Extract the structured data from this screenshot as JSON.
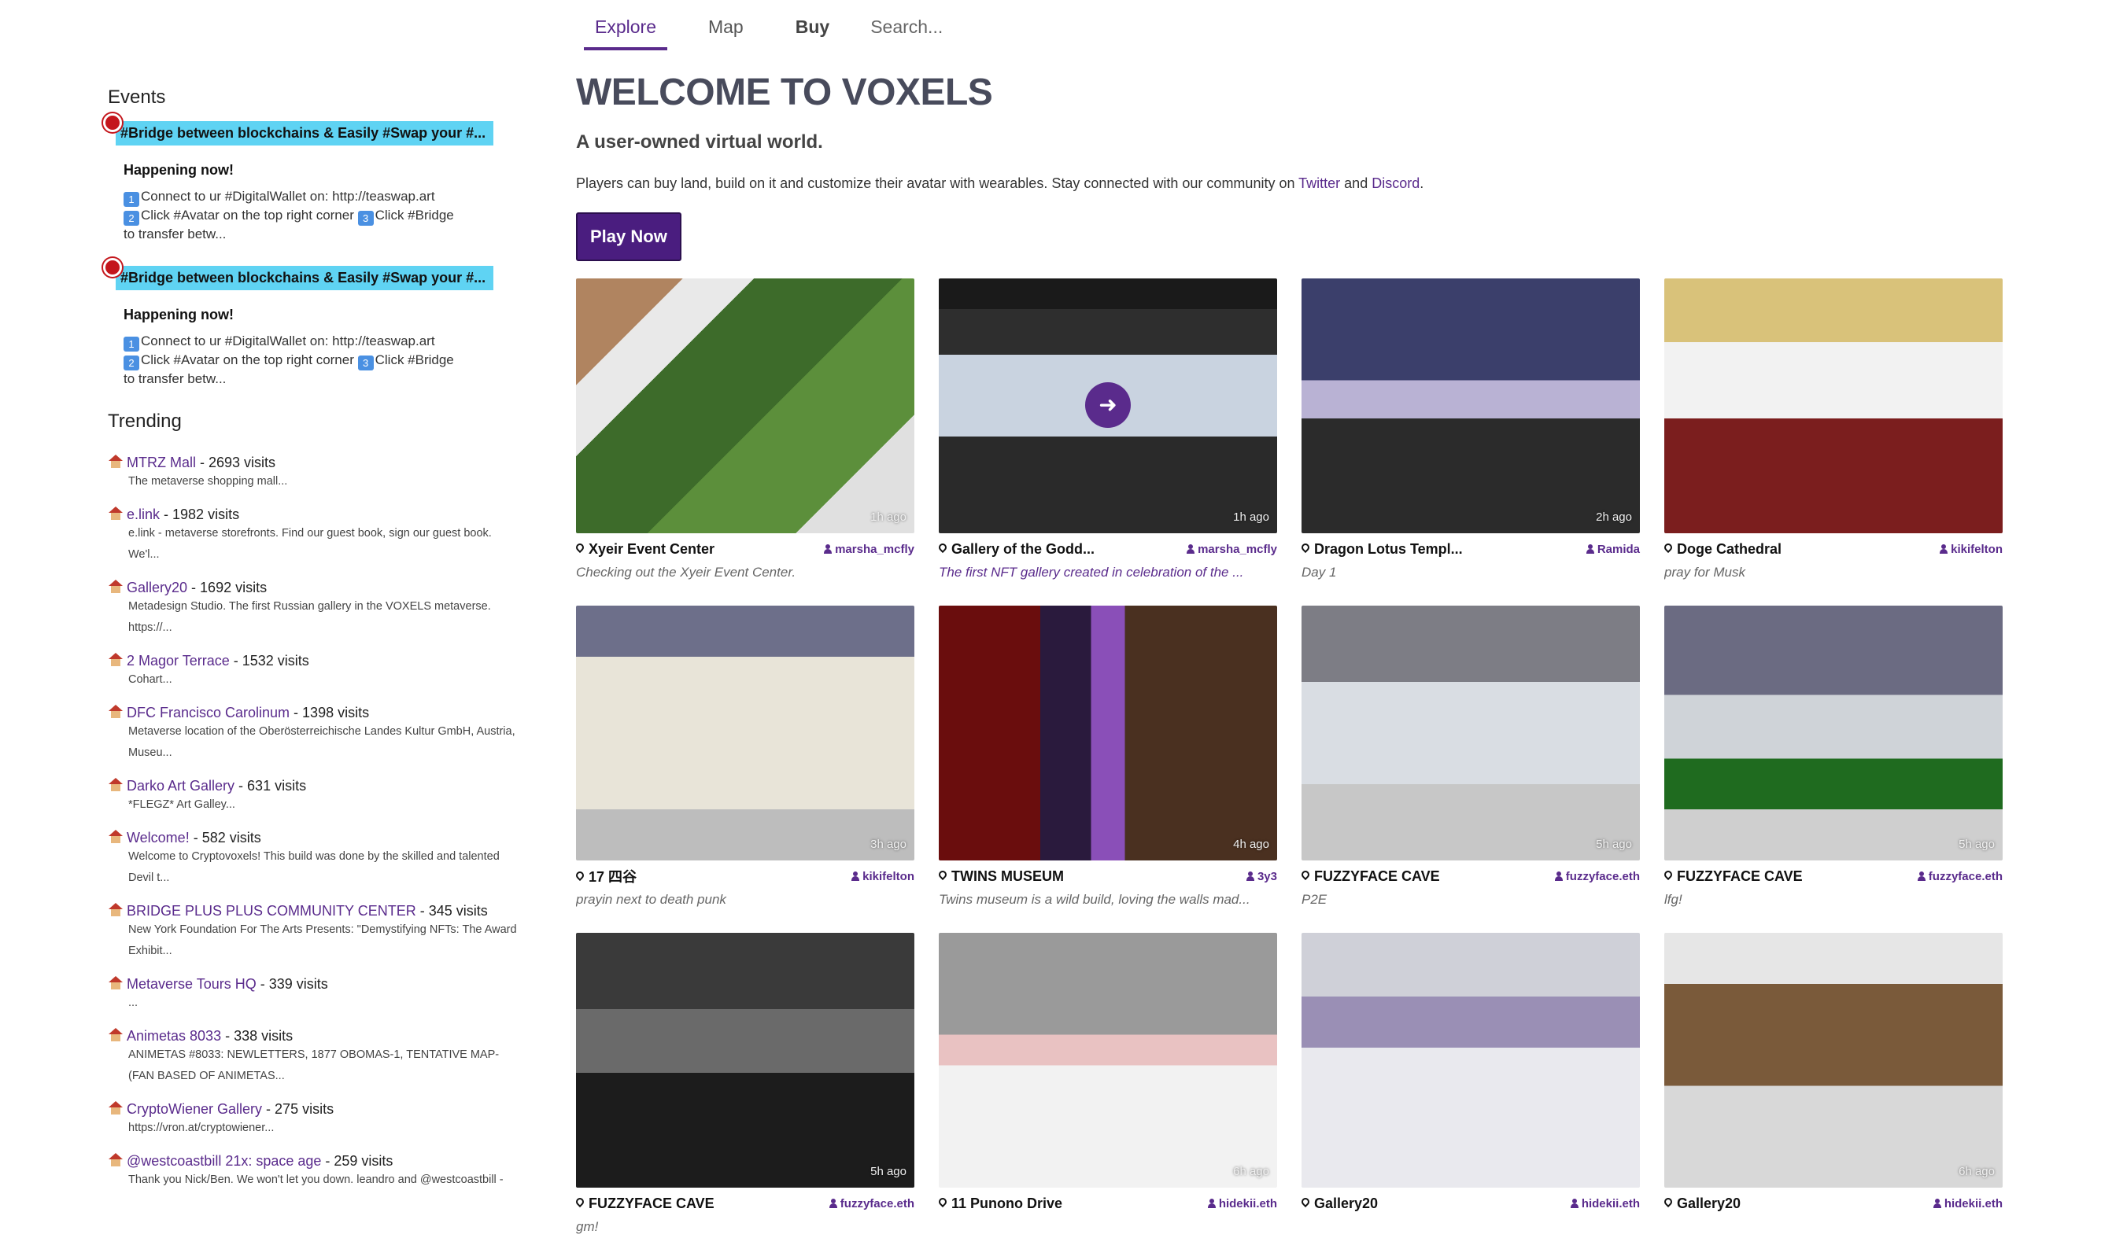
{
  "nav": {
    "items": [
      {
        "label": "Explore"
      },
      {
        "label": "Map"
      },
      {
        "label": "Buy"
      }
    ],
    "search_placeholder": "Search..."
  },
  "sidebar": {
    "events_heading": "Events",
    "events": [
      {
        "title": "#Bridge between blockchains & Easily #Swap your #...",
        "status": "Happening now!",
        "line1": "Connect to ur #DigitalWallet on: http://teaswap.art",
        "line2a": "Click #Avatar on the top right corner ",
        "line2b": "Click #Bridge",
        "line3": "to transfer betw..."
      },
      {
        "title": "#Bridge between blockchains & Easily #Swap your #...",
        "status": "Happening now!",
        "line1": "Connect to ur #DigitalWallet on: http://teaswap.art",
        "line2a": "Click #Avatar on the top right corner ",
        "line2b": "Click #Bridge",
        "line3": "to transfer betw..."
      }
    ],
    "trending_heading": "Trending",
    "trending": [
      {
        "name": "MTRZ Mall",
        "visits": " - 2693 visits",
        "desc": "The metaverse shopping mall..."
      },
      {
        "name": "e.link",
        "visits": " - 1982 visits",
        "desc": "e.link - metaverse storefronts. Find our guest book, sign our guest book. We'l..."
      },
      {
        "name": "Gallery20",
        "visits": " - 1692 visits",
        "desc": "Metadesign Studio. The first Russian gallery in the VOXELS metaverse. https://..."
      },
      {
        "name": "2 Magor Terrace",
        "visits": " - 1532 visits",
        "desc": "Cohart..."
      },
      {
        "name": "DFC Francisco Carolinum",
        "visits": " - 1398 visits",
        "desc": "Metaverse location of the Oberösterreichische Landes Kultur GmbH, Austria, Museu..."
      },
      {
        "name": "Darko Art Gallery",
        "visits": " - 631 visits",
        "desc": "*FLEGZ* Art Galley..."
      },
      {
        "name": "Welcome!",
        "visits": " - 582 visits",
        "desc": "Welcome to Cryptovoxels! This build was done by the skilled and talented Devil t..."
      },
      {
        "name": "BRIDGE PLUS PLUS COMMUNITY CENTER",
        "visits": " - 345 visits",
        "desc": "New York Foundation For The Arts Presents: \"Demystifying NFTs: The Award Exhibit..."
      },
      {
        "name": "Metaverse Tours HQ",
        "visits": " - 339 visits",
        "desc": "..."
      },
      {
        "name": "Animetas 8033",
        "visits": " - 338 visits",
        "desc": "ANIMETAS #8033: NEWLETTERS, 1877 OBOMAS-1, TENTATIVE MAP- (FAN BASED OF ANIMETAS..."
      },
      {
        "name": "CryptoWiener Gallery",
        "visits": " - 275 visits",
        "desc": "https://vron.at/cryptowiener..."
      },
      {
        "name": "@westcoastbill 21x: space age",
        "visits": " - 259 visits",
        "desc": "Thank you Nick/Ben. We won't let you down. leandro and @westcoastbill -"
      }
    ]
  },
  "main": {
    "title": "WELCOME TO VOXELS",
    "subtitle": "A user-owned virtual world.",
    "intro_prefix": "Players can buy land, build on it and customize their avatar with wearables. Stay connected with our community on ",
    "intro_link1": "Twitter",
    "intro_mid": " and ",
    "intro_link2": "Discord",
    "intro_suffix": ".",
    "play_label": "Play Now"
  },
  "cards": [
    {
      "title": "Xyeir Event Center",
      "author": "marsha_mcfly",
      "time": "1h ago",
      "desc": "Checking out the Xyeir Event Center.",
      "desc_purple": false,
      "play": false
    },
    {
      "title": "Gallery of the Godd...",
      "author": "marsha_mcfly",
      "time": "1h ago",
      "desc": "The first NFT gallery created in celebration of the ...",
      "desc_purple": true,
      "play": true
    },
    {
      "title": "Dragon Lotus Templ...",
      "author": "Ramida",
      "time": "2h ago",
      "desc": "Day 1",
      "desc_purple": false,
      "play": false
    },
    {
      "title": "Doge Cathedral",
      "author": "kikifelton",
      "time": "",
      "desc": "pray for Musk",
      "desc_purple": false,
      "play": false
    },
    {
      "title": "17 四谷",
      "author": "kikifelton",
      "time": "3h ago",
      "desc": "prayin next to death punk",
      "desc_purple": false,
      "play": false
    },
    {
      "title": "TWINS MUSEUM",
      "author": "3y3",
      "time": "4h ago",
      "desc": "Twins museum is a wild build, loving the walls mad...",
      "desc_purple": false,
      "play": false
    },
    {
      "title": "FUZZYFACE CAVE",
      "author": "fuzzyface.eth",
      "time": "5h ago",
      "desc": "P2E",
      "desc_purple": false,
      "play": false
    },
    {
      "title": "FUZZYFACE CAVE",
      "author": "fuzzyface.eth",
      "time": "5h ago",
      "desc": "lfg!",
      "desc_purple": false,
      "play": false
    },
    {
      "title": "FUZZYFACE CAVE",
      "author": "fuzzyface.eth",
      "time": "5h ago",
      "desc": "gm!",
      "desc_purple": false,
      "play": false
    },
    {
      "title": "11 Punono Drive",
      "author": "hidekii.eth",
      "time": "6h ago",
      "desc": "",
      "desc_purple": false,
      "play": false
    },
    {
      "title": "Gallery20",
      "author": "hidekii.eth",
      "time": "",
      "desc": "",
      "desc_purple": false,
      "play": false
    },
    {
      "title": "Gallery20",
      "author": "hidekii.eth",
      "time": "6h ago",
      "desc": "",
      "desc_purple": false,
      "play": false
    }
  ],
  "colors": {
    "brand_purple": "#5a2b8c",
    "play_button": "#4a1d7f",
    "event_highlight": "#5fd3f3",
    "event_dot": "#c4161c"
  }
}
